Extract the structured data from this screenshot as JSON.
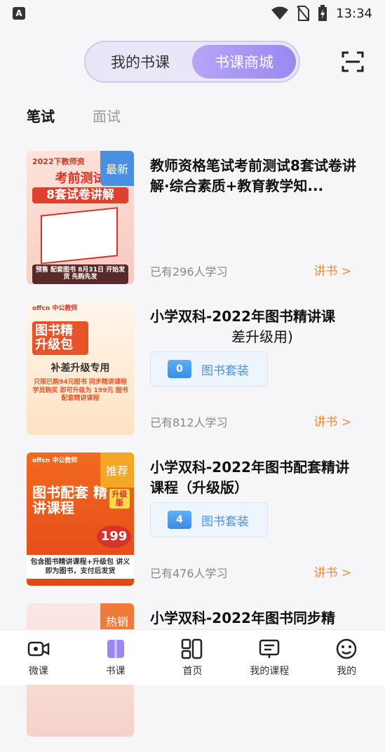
{
  "status": {
    "time": "13:34",
    "a_label": "A"
  },
  "segment": {
    "my_courses": "我的书课",
    "store": "书课商城"
  },
  "sub_tabs": {
    "written": "笔试",
    "interview": "面试"
  },
  "items": [
    {
      "title": "教师资格笔试考前测试8套试卷讲解·综合素质+教育教学知...",
      "badge": "最新",
      "badge_color": "#4a90e2",
      "cover_top": "2022下教师资",
      "cover_main": "考前测试",
      "cover_sub": "8套试卷讲解",
      "cover_foot": "预售 配套图书 8月31日 开始发货 先购先发",
      "learners": "已有296人学习",
      "lecture": "讲书 >"
    },
    {
      "title": "小学双科-2022年图书精讲课",
      "title2": "差升级用)",
      "package_count": "0",
      "package_label": "图书套装",
      "cover_brand": "offcn 中公教师",
      "cover_main": "图书精 升级包",
      "cover_sub": "补差升级专用",
      "cover_foot": "只限已购94元图书 同步精讲课程学员购买 即可升级为 199元 图书配套精讲课程",
      "learners": "已有812人学习",
      "lecture": "讲书 >"
    },
    {
      "title": "小学双科-2022年图书配套精讲课程（升级版）",
      "badge": "推荐",
      "badge_color": "#f5a623",
      "package_count": "4",
      "package_label": "图书套装",
      "cover_brand": "offcn 中公教师",
      "cover_main": "图书配套 精讲课程",
      "cover_tag": "升级版",
      "cover_price": "199",
      "cover_foot": "包含图书精讲课程+升级包 讲义即为图书，支付后发货",
      "learners": "已有476人学习",
      "lecture": "讲书 >"
    },
    {
      "title": "小学双科-2022年图书同步精",
      "badge": "热销",
      "badge_color": "#f07a3a"
    }
  ],
  "nav": [
    {
      "label": "微课",
      "icon": "video-camera-icon"
    },
    {
      "label": "书课",
      "icon": "book-icon"
    },
    {
      "label": "首页",
      "icon": "home-grid-icon"
    },
    {
      "label": "我的课程",
      "icon": "course-screen-icon"
    },
    {
      "label": "我的",
      "icon": "smiley-face-icon"
    }
  ]
}
